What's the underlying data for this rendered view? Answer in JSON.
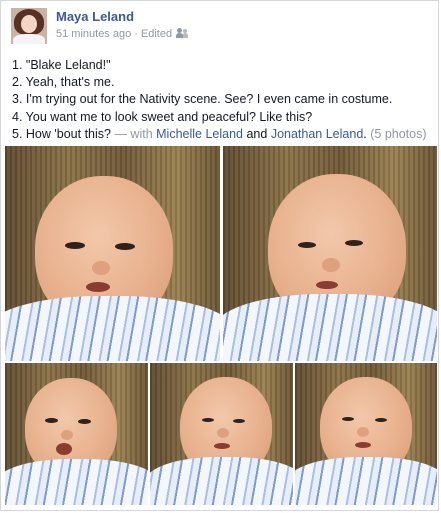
{
  "post": {
    "author": "Maya Leland",
    "time": "51 minutes ago",
    "separator": "·",
    "edited": "Edited",
    "audience_icon": "friends-icon",
    "lines": [
      "1. \"Blake Leland!\"",
      "2. Yeah, that's me.",
      "3. I'm trying out for the Nativity scene. See? I even came in costume.",
      "4. You want me to look sweet and peaceful? Like this?"
    ],
    "last_line": {
      "text": "5. How 'bout this?",
      "with": "— with",
      "tag1": "Michelle Leland",
      "and": "and",
      "tag2": "Jonathan Leland",
      "period": ".",
      "photo_count": "(5 photos)"
    }
  },
  "colors": {
    "link": "#3b5998",
    "muted": "#9197a3",
    "text": "#141823",
    "border": "#d3d6db"
  },
  "photos": [
    {
      "name": "photo-1",
      "subject": "newborn in striped swaddle blanket"
    },
    {
      "name": "photo-2",
      "subject": "newborn in striped swaddle blanket"
    },
    {
      "name": "photo-3",
      "subject": "newborn in striped swaddle blanket"
    },
    {
      "name": "photo-4",
      "subject": "newborn in striped swaddle blanket"
    },
    {
      "name": "photo-5",
      "subject": "newborn in striped swaddle blanket"
    }
  ]
}
